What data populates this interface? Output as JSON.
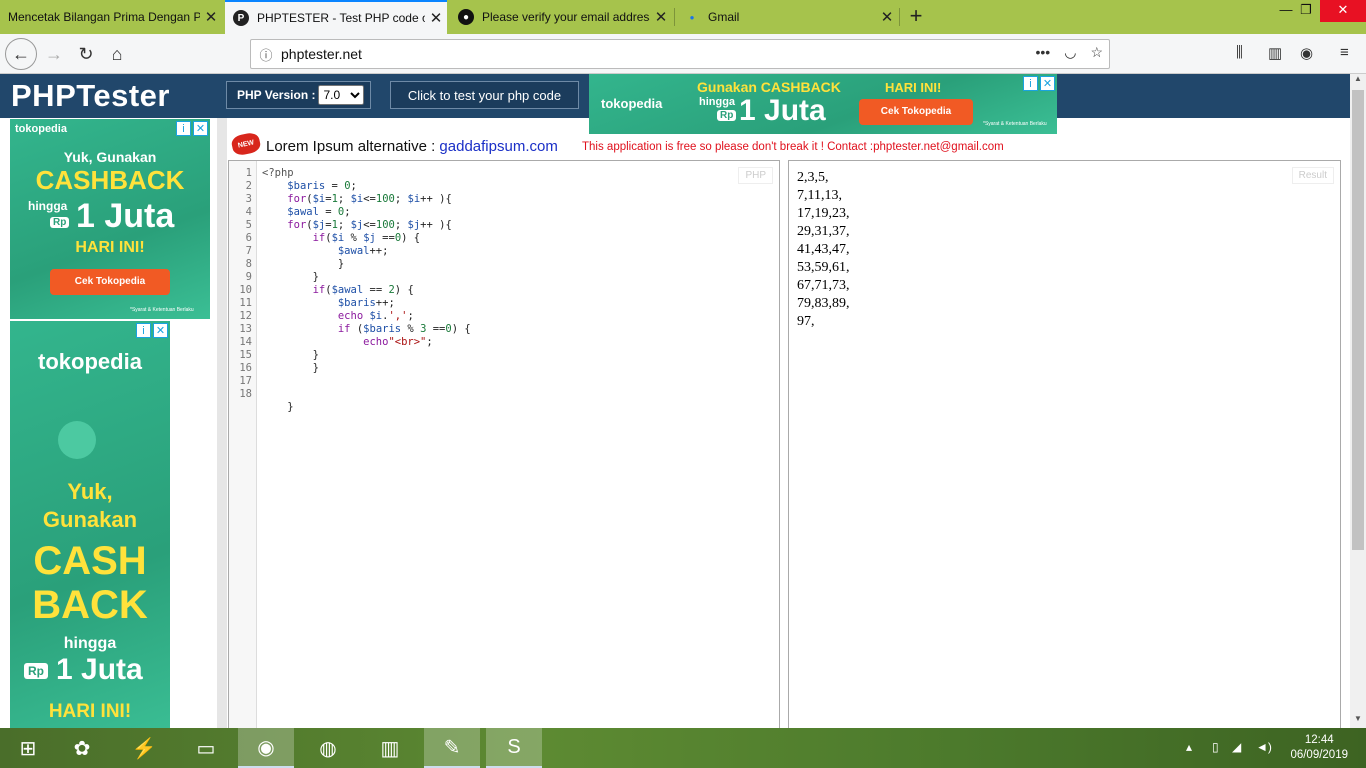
{
  "browser": {
    "tabs": [
      {
        "title": "Mencetak Bilangan Prima Dengan P",
        "active": false,
        "icon": "page-icon"
      },
      {
        "title": "PHPTESTER - Test PHP code on",
        "active": true,
        "icon": "phptester-icon"
      },
      {
        "title": "Please verify your email address",
        "active": false,
        "icon": "github-icon"
      },
      {
        "title": "Gmail",
        "active": false,
        "icon": "gmail-icon"
      }
    ],
    "new_tab": "+",
    "url": "phptester.net"
  },
  "page": {
    "logo": "PHPTester",
    "php_version_label": "PHP Version :",
    "php_version_value": "7.0",
    "run_button": "Click to test your php code",
    "new_badge": "NEW",
    "lorem_prefix": "Lorem Ipsum alternative :",
    "lorem_link": "gaddafipsum.com",
    "notice": "This application is free so please don't break it ! Contact :phptester.net@gmail.com",
    "editor_label": "PHP",
    "result_label": "Result",
    "line_numbers": [
      "1",
      "2",
      "3",
      "4",
      "5",
      "6",
      "7",
      "8",
      "9",
      "10",
      "11",
      "12",
      "13",
      "14",
      "15",
      "16",
      "17",
      "18"
    ],
    "output_lines": [
      "2,3,5,",
      "7,11,13,",
      "17,19,23,",
      "29,31,37,",
      "41,43,47,",
      "53,59,61,",
      "67,71,73,",
      "79,83,89,",
      "97,"
    ]
  },
  "ads": {
    "top": {
      "brand": "tokopedia",
      "headline": "Gunakan CASHBACK",
      "hingga": "hingga",
      "rp": "Rp",
      "amount": "1 Juta",
      "today": "HARI INI!",
      "cta": "Cek Tokopedia",
      "fine": "*Syarat & Ketentuan Berlaku"
    },
    "left1": {
      "brand": "tokopedia",
      "line1": "Yuk, Gunakan",
      "line2": "CASHBACK",
      "hingga": "hingga",
      "rp": "Rp",
      "amount": "1 Juta",
      "today": "HARI INI!",
      "cta": "Cek Tokopedia",
      "fine": "*Syarat & Ketentuan Berlaku"
    },
    "left2": {
      "brand": "tokopedia",
      "line1": "Yuk,",
      "line2": "Gunakan",
      "line3": "CASH",
      "line4": "BACK",
      "hingga": "hingga",
      "rp": "Rp",
      "amount": "1 Juta",
      "today": "HARI INI!"
    }
  },
  "taskbar": {
    "clock_time": "12:44",
    "clock_date": "06/09/2019"
  }
}
